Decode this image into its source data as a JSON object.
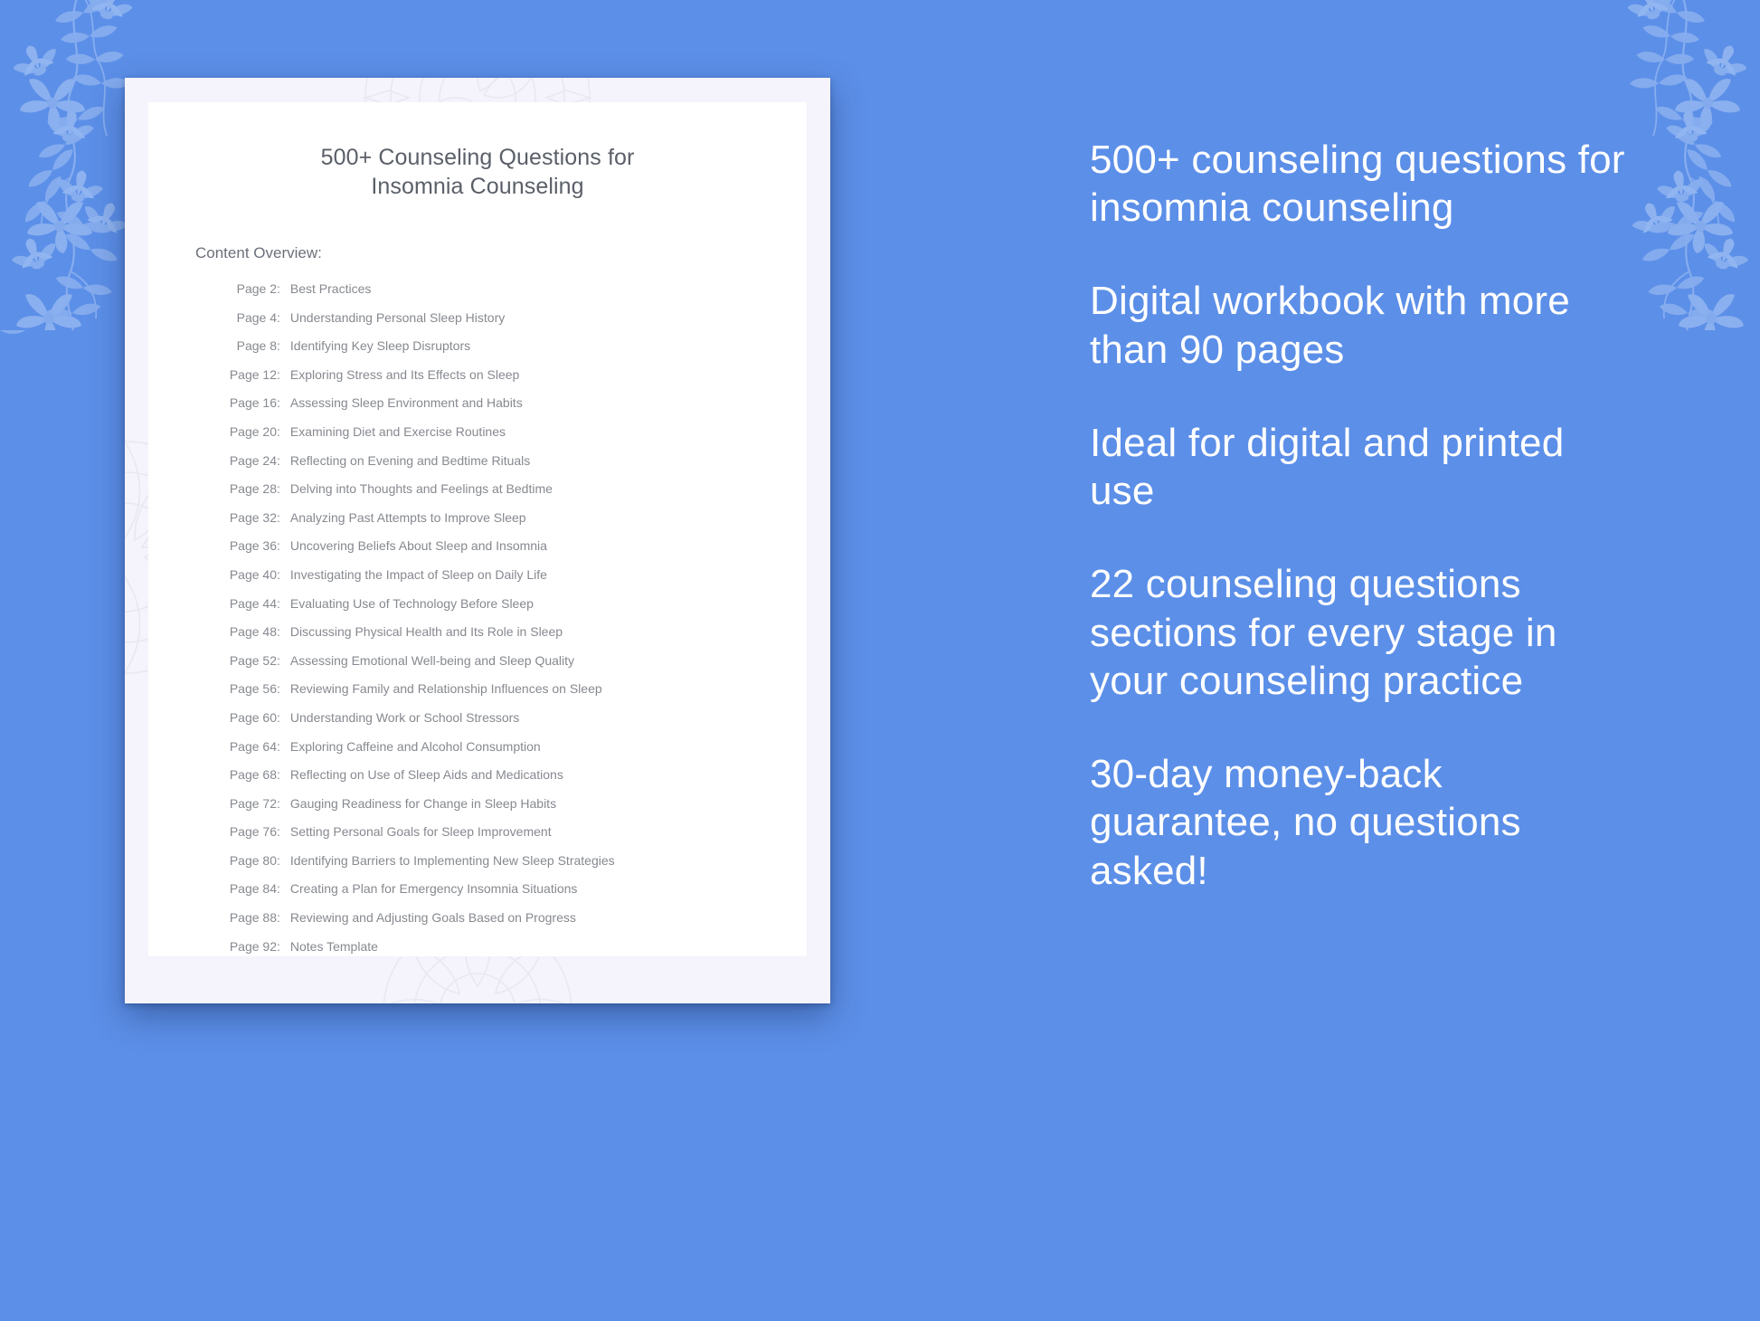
{
  "theme": {
    "background_blue": "#5c8fe8",
    "card_border": "#f5f3fb",
    "page_white": "#ffffff",
    "promo_text": "#ffffff",
    "doc_text": "#86898f"
  },
  "document": {
    "title_lines": [
      "500+ Counseling Questions for",
      "Insomnia Counseling"
    ],
    "content_overview_label": "Content Overview:",
    "toc": [
      {
        "page": "Page  2",
        "sep": ":",
        "title": "Best Practices"
      },
      {
        "page": "Page  4",
        "sep": ":",
        "title": "Understanding Personal Sleep History"
      },
      {
        "page": "Page  8",
        "sep": ":",
        "title": "Identifying Key Sleep Disruptors"
      },
      {
        "page": "Page 12",
        "sep": ":",
        "title": "Exploring Stress and Its Effects on Sleep"
      },
      {
        "page": "Page 16",
        "sep": ":",
        "title": "Assessing Sleep Environment and Habits"
      },
      {
        "page": "Page 20",
        "sep": ":",
        "title": "Examining Diet and Exercise Routines"
      },
      {
        "page": "Page 24",
        "sep": ":",
        "title": "Reflecting on Evening and Bedtime Rituals"
      },
      {
        "page": "Page 28",
        "sep": ":",
        "title": "Delving into Thoughts and Feelings at Bedtime"
      },
      {
        "page": "Page 32",
        "sep": ":",
        "title": "Analyzing Past Attempts to Improve Sleep"
      },
      {
        "page": "Page 36",
        "sep": ":",
        "title": "Uncovering Beliefs About Sleep and Insomnia"
      },
      {
        "page": "Page 40",
        "sep": ":",
        "title": "Investigating the Impact of Sleep on Daily Life"
      },
      {
        "page": "Page 44",
        "sep": ":",
        "title": "Evaluating Use of Technology Before Sleep"
      },
      {
        "page": "Page 48",
        "sep": ":",
        "title": "Discussing Physical Health and Its Role in Sleep"
      },
      {
        "page": "Page 52",
        "sep": ":",
        "title": "Assessing Emotional Well-being and Sleep Quality"
      },
      {
        "page": "Page 56",
        "sep": ":",
        "title": "Reviewing Family and Relationship Influences on Sleep"
      },
      {
        "page": "Page 60",
        "sep": ":",
        "title": "Understanding Work or School Stressors"
      },
      {
        "page": "Page 64",
        "sep": ":",
        "title": "Exploring Caffeine and Alcohol Consumption"
      },
      {
        "page": "Page 68",
        "sep": ":",
        "title": "Reflecting on Use of Sleep Aids and Medications"
      },
      {
        "page": "Page 72",
        "sep": ":",
        "title": "Gauging Readiness for Change in Sleep Habits"
      },
      {
        "page": "Page 76",
        "sep": ":",
        "title": "Setting Personal Goals for Sleep Improvement"
      },
      {
        "page": "Page 80",
        "sep": ":",
        "title": "Identifying Barriers to Implementing New Sleep Strategies"
      },
      {
        "page": "Page 84",
        "sep": ":",
        "title": "Creating a Plan for Emergency Insomnia Situations"
      },
      {
        "page": "Page 88",
        "sep": ":",
        "title": "Reviewing and Adjusting Goals Based on Progress"
      },
      {
        "page": "Page 92",
        "sep": ":",
        "title": "Notes Template"
      }
    ]
  },
  "marketing": {
    "promos": [
      "500+ counseling questions for insomnia counseling",
      "Digital workbook with more than 90 pages",
      "Ideal for digital and printed use",
      "22 counseling questions sections for every stage in your counseling practice",
      "30-day money-back guarantee, no questions asked!"
    ]
  }
}
